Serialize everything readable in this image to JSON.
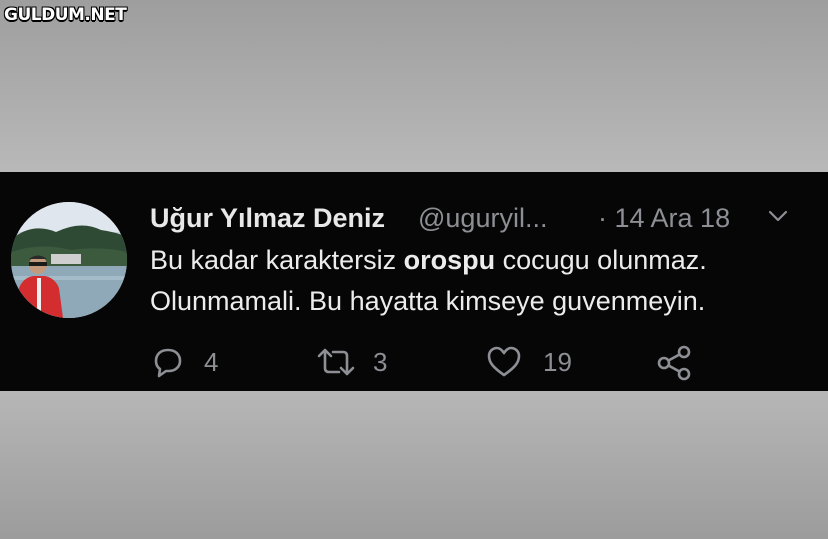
{
  "watermark": "GULDUM.NET",
  "tweet": {
    "author_name": "Uğur Yılmaz Deniz",
    "handle": "@uguryil...",
    "date": "· 14 Ara 18",
    "text_part1": "Bu kadar karaktersiz ",
    "text_bold": "orospu",
    "text_part2": " cocugu olunmaz.",
    "text_line2": "Olunmamali. Bu hayatta kimseye guvenmeyin.",
    "replies": "4",
    "retweets": "3",
    "likes": "19"
  },
  "icons": {
    "reply": "reply-icon",
    "retweet": "retweet-icon",
    "like": "heart-icon",
    "share": "share-icon",
    "more": "chevron-down-icon"
  },
  "colors": {
    "tweet_background": "#060607",
    "text_primary": "#ececec",
    "text_secondary": "#8d8f94"
  }
}
